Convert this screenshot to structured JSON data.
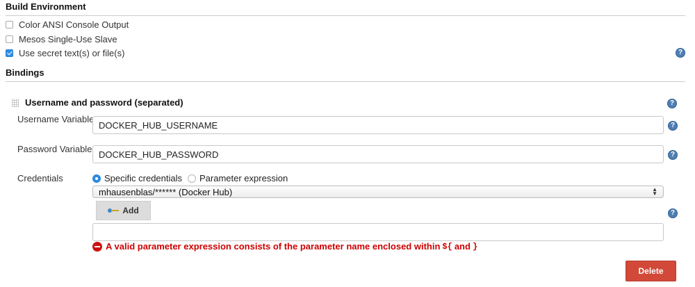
{
  "build_environment": {
    "title": "Build Environment",
    "options": [
      {
        "label": "Color ANSI Console Output",
        "checked": false
      },
      {
        "label": "Mesos Single-Use Slave",
        "checked": false
      },
      {
        "label": "Use secret text(s) or file(s)",
        "checked": true
      }
    ]
  },
  "bindings": {
    "title": "Bindings",
    "binding_title": "Username and password (separated)",
    "username": {
      "label": "Username Variable",
      "value": "DOCKER_HUB_USERNAME"
    },
    "password": {
      "label": "Password Variable",
      "value": "DOCKER_HUB_PASSWORD"
    },
    "credentials": {
      "label": "Credentials",
      "radio_specific": "Specific credentials",
      "radio_parameter": "Parameter expression",
      "selected_mode": "Specific credentials",
      "selected_credential": "mhausenblas/****** (Docker Hub)",
      "add_label": "Add",
      "parameter_value": ""
    },
    "error": {
      "text_before": "A valid parameter expression consists of the parameter name enclosed within",
      "code_open": "${",
      "text_and": "and",
      "code_close": "}"
    },
    "delete_label": "Delete"
  },
  "help_icon_glyph": "?",
  "colors": {
    "checkbox_checked": "#2f8ee5",
    "help_icon": "#4f7fb3",
    "error_text": "#cc0000",
    "delete_button": "#d24939"
  }
}
